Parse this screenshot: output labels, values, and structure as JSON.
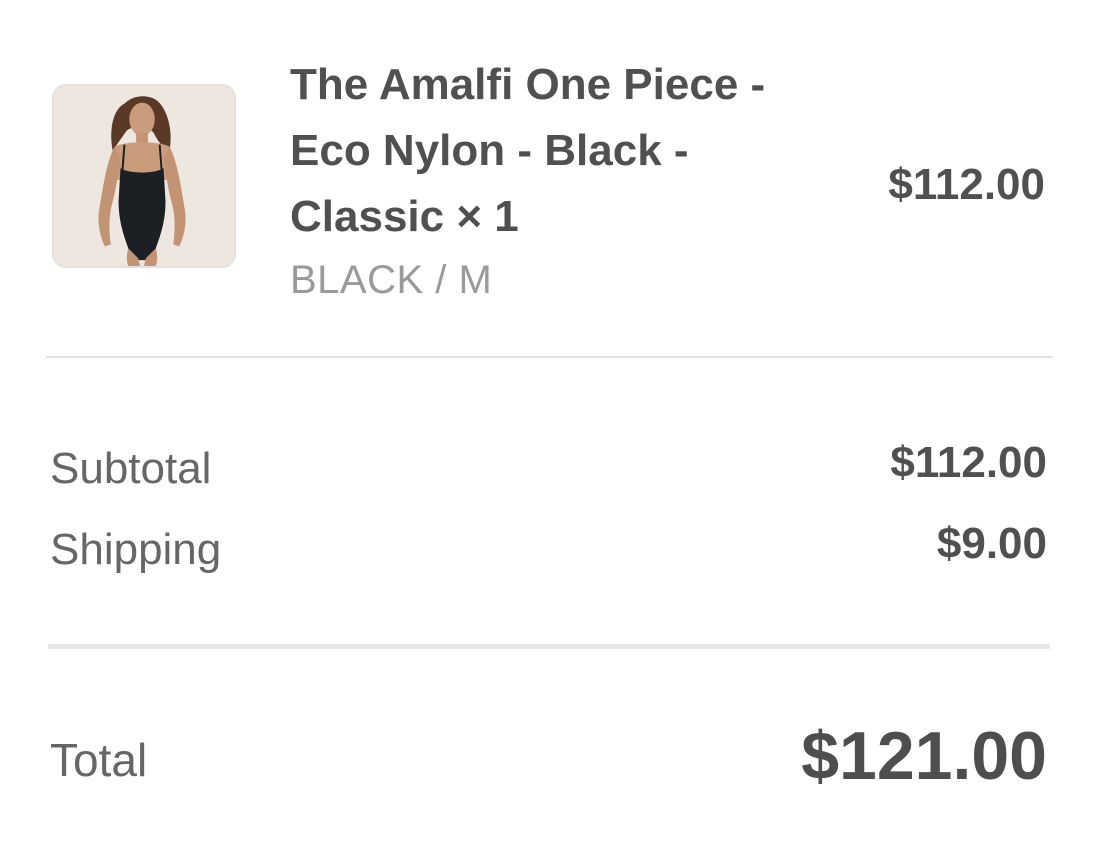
{
  "line_item": {
    "image_icon": "product-photo-swimsuit",
    "title": "The Amalfi One Piece - Eco Nylon - Black - Classic × 1",
    "variant": "BLACK / M",
    "price": "$112.00"
  },
  "summary": {
    "subtotal_label": "Subtotal",
    "subtotal_value": "$112.00",
    "shipping_label": "Shipping",
    "shipping_value": "$9.00",
    "total_label": "Total",
    "total_value": "$121.00"
  }
}
